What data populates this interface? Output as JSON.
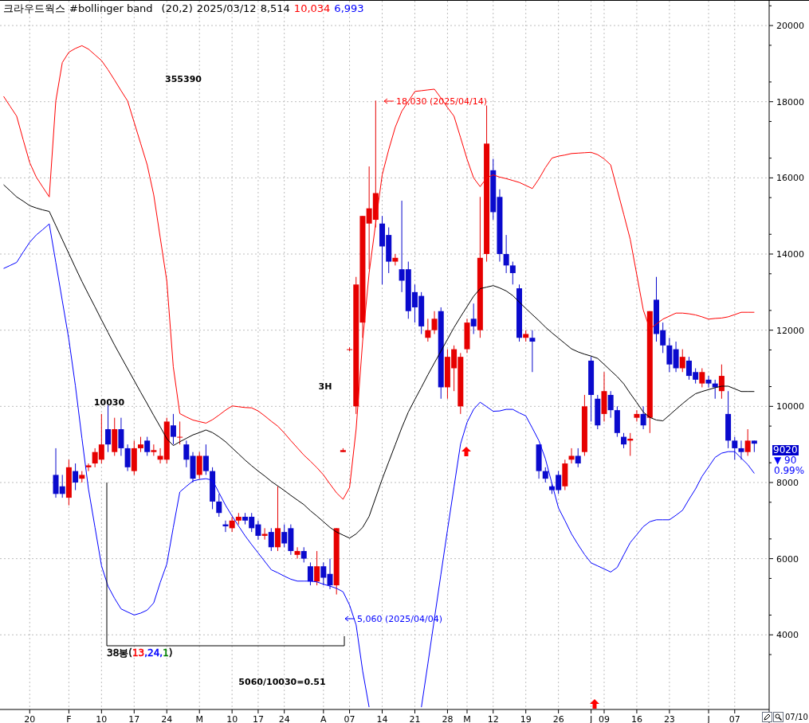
{
  "header": {
    "title": "크라우드웍스",
    "indicator": "#bollinger band",
    "params": "(20,2)",
    "date": "2025/03/12",
    "close": "8,514",
    "upper": "10,034",
    "lower": "6,993"
  },
  "price_tag": {
    "price": "9020",
    "change": "▼ 90",
    "percent": "0.99%"
  },
  "footer": {
    "date_label": "07/10"
  },
  "chart": {
    "range_label": [
      {
        "text": "38봉(",
        "color": "#000000"
      },
      {
        "text": "13",
        "color": "#ff0000"
      },
      {
        "text": ",24,",
        "color": "#0000ff"
      },
      {
        "text": "1",
        "color": "#008000"
      },
      {
        "text": ")",
        "color": "#000000"
      }
    ],
    "chart_data": {
      "type": "candlestick",
      "grid": true,
      "ylim": [
        2040,
        20650
      ],
      "yticks": [
        4000,
        6000,
        8000,
        10000,
        12000,
        14000,
        16000,
        18000,
        20000
      ],
      "categories": [
        null,
        null,
        null,
        null,
        "20",
        null,
        null,
        null,
        null,
        null,
        "F",
        null,
        null,
        null,
        null,
        "10",
        null,
        null,
        null,
        null,
        "17",
        null,
        null,
        null,
        null,
        "24",
        null,
        null,
        null,
        null,
        "M",
        null,
        null,
        null,
        null,
        "10",
        null,
        null,
        null,
        "17",
        null,
        null,
        null,
        "24",
        null,
        null,
        null,
        null,
        null,
        "A",
        null,
        null,
        null,
        "07",
        null,
        null,
        null,
        null,
        "14",
        null,
        null,
        null,
        null,
        "21",
        null,
        null,
        null,
        null,
        "28",
        null,
        null,
        "M",
        null,
        null,
        null,
        "12",
        null,
        null,
        null,
        null,
        "19",
        null,
        null,
        null,
        null,
        "26",
        null,
        null,
        null,
        null,
        "J",
        null,
        "09",
        null,
        null,
        null,
        null,
        "16",
        null,
        null,
        null,
        null,
        "23",
        null,
        null,
        null,
        null,
        null,
        "J",
        null,
        null,
        null,
        "07",
        null,
        null,
        null
      ],
      "series": [
        {
          "type": "line",
          "color": "#ff0000",
          "values": [
            18140,
            17880,
            17620,
            17000,
            16400,
            16020,
            15760,
            15500,
            18020,
            19030,
            19300,
            19400,
            19470,
            19380,
            19230,
            19080,
            18840,
            18570,
            18290,
            18020,
            17460,
            16900,
            16340,
            15550,
            14420,
            13290,
            11040,
            9810,
            9720,
            9640,
            9600,
            9560,
            9650,
            9770,
            9900,
            10010,
            9990,
            9970,
            9960,
            9880,
            9750,
            9610,
            9480,
            9300,
            9100,
            8910,
            8720,
            8560,
            8390,
            8200,
            7960,
            7730,
            7560,
            7870,
            9400,
            11720,
            13500,
            14800,
            16080,
            16740,
            17330,
            17750,
            18010,
            18270,
            18290,
            18310,
            18330,
            18100,
            17850,
            17620,
            17060,
            16490,
            16000,
            15770,
            16000,
            16080,
            16020,
            15980,
            15930,
            15880,
            15800,
            15720,
            15970,
            16270,
            16520,
            16570,
            16600,
            16640,
            16650,
            16660,
            16670,
            16610,
            16500,
            16340,
            15690,
            15040,
            14390,
            13460,
            12530,
            12030,
            12160,
            12290,
            12370,
            12450,
            12450,
            12430,
            12400,
            12350,
            12290,
            12310,
            12320,
            12350,
            12410,
            12470,
            12470,
            12470
          ]
        },
        {
          "type": "line",
          "color": "#000000",
          "values": [
            15820,
            15660,
            15500,
            15390,
            15270,
            15210,
            15160,
            15120,
            14750,
            14380,
            14010,
            13640,
            13280,
            12940,
            12610,
            12270,
            11940,
            11610,
            11300,
            10990,
            10680,
            10370,
            10070,
            9760,
            9460,
            9150,
            8970,
            9070,
            9160,
            9250,
            9310,
            9380,
            9310,
            9200,
            9070,
            8910,
            8750,
            8590,
            8440,
            8300,
            8170,
            8030,
            7910,
            7790,
            7660,
            7540,
            7420,
            7260,
            7120,
            6970,
            6820,
            6700,
            6620,
            6540,
            6650,
            6820,
            7110,
            7600,
            8090,
            8540,
            8990,
            9440,
            9850,
            10180,
            10500,
            10830,
            11140,
            11450,
            11760,
            12070,
            12350,
            12620,
            12890,
            13090,
            13130,
            13170,
            13110,
            13030,
            12910,
            12740,
            12570,
            12410,
            12250,
            12080,
            11930,
            11790,
            11650,
            11510,
            11430,
            11370,
            11320,
            11260,
            11100,
            10940,
            10780,
            10590,
            10340,
            10100,
            9850,
            9710,
            9640,
            9620,
            9770,
            9920,
            10070,
            10210,
            10330,
            10390,
            10440,
            10490,
            10530,
            10530,
            10460,
            10390,
            10390,
            10390
          ]
        },
        {
          "type": "line",
          "color": "#0000ff",
          "values": [
            13620,
            13700,
            13780,
            14050,
            14310,
            14500,
            14640,
            14790,
            13780,
            12770,
            11760,
            10540,
            9160,
            7830,
            6820,
            5810,
            5280,
            4960,
            4680,
            4600,
            4520,
            4570,
            4650,
            4840,
            5380,
            5860,
            6820,
            7750,
            7900,
            8040,
            8080,
            8100,
            8060,
            7730,
            7400,
            7120,
            6860,
            6600,
            6370,
            6150,
            5930,
            5710,
            5630,
            5540,
            5460,
            5410,
            5410,
            5410,
            5390,
            5330,
            5280,
            5220,
            5130,
            4780,
            4260,
            3050,
            2100,
            null,
            null,
            null,
            null,
            null,
            null,
            null,
            2100,
            3250,
            4420,
            5590,
            6750,
            7880,
            9010,
            9580,
            9920,
            10110,
            9990,
            9870,
            9880,
            9920,
            9920,
            9830,
            9750,
            9430,
            9100,
            8620,
            7970,
            7330,
            7000,
            6650,
            6370,
            6110,
            5890,
            5810,
            5730,
            5650,
            5770,
            6100,
            6420,
            6630,
            6840,
            6970,
            7020,
            7020,
            7020,
            7140,
            7270,
            7560,
            7830,
            8160,
            8410,
            8660,
            8770,
            8810,
            8810,
            8640,
            8470,
            8240
          ]
        }
      ],
      "ohlc": [
        null,
        null,
        null,
        null,
        null,
        null,
        null,
        null,
        [
          8200,
          8900,
          7600,
          7700
        ],
        [
          7900,
          8200,
          7600,
          7700
        ],
        [
          7600,
          8600,
          7400,
          8400
        ],
        [
          8300,
          8500,
          7800,
          8000
        ],
        [
          8100,
          8300,
          8000,
          8200
        ],
        [
          8400,
          8500,
          8300,
          8450
        ],
        [
          8500,
          8900,
          8400,
          8800
        ],
        [
          8600,
          9800,
          8500,
          9000
        ],
        [
          9400,
          10030,
          8800,
          9000
        ],
        [
          8800,
          9700,
          8700,
          9400
        ],
        [
          9400,
          9700,
          8700,
          8900
        ],
        [
          8900,
          9000,
          8300,
          8400
        ],
        [
          8300,
          9100,
          8200,
          8900
        ],
        [
          8900,
          9200,
          8800,
          9000
        ],
        [
          9100,
          9200,
          8700,
          8800
        ],
        [
          8800,
          9000,
          8700,
          8850
        ],
        [
          8600,
          8900,
          8500,
          8700
        ],
        [
          8600,
          9700,
          8500,
          9600
        ],
        [
          9500,
          9800,
          9000,
          9200
        ],
        [
          9200,
          9600,
          9000,
          9200
        ],
        [
          9000,
          9100,
          8400,
          8600
        ],
        [
          8700,
          8800,
          8000,
          8100
        ],
        [
          8200,
          8800,
          8100,
          8700
        ],
        [
          8700,
          9000,
          8200,
          8300
        ],
        [
          8300,
          8400,
          7300,
          7500
        ],
        [
          7500,
          7700,
          7100,
          7200
        ],
        [
          6900,
          7000,
          6700,
          6850
        ],
        [
          6800,
          7100,
          6700,
          7000
        ],
        [
          7000,
          7200,
          6900,
          7100
        ],
        [
          7100,
          7200,
          6900,
          7000
        ],
        [
          7100,
          7200,
          6700,
          6800
        ],
        [
          6900,
          7000,
          6500,
          6600
        ],
        [
          6600,
          6800,
          6500,
          6650
        ],
        [
          6700,
          6800,
          6200,
          6300
        ],
        [
          6300,
          7900,
          6200,
          6800
        ],
        [
          6700,
          6900,
          6300,
          6400
        ],
        [
          6800,
          6900,
          6100,
          6200
        ],
        [
          6100,
          6300,
          6000,
          6200
        ],
        [
          6200,
          6300,
          5900,
          6000
        ],
        [
          5800,
          5900,
          5300,
          5400
        ],
        [
          5400,
          6200,
          5300,
          5800
        ],
        [
          5800,
          5900,
          5300,
          5500
        ],
        [
          5600,
          6000,
          5200,
          5300
        ],
        [
          5300,
          6800,
          5060,
          6800
        ],
        [
          8800,
          8900,
          8800,
          8850
        ],
        [
          11500,
          11550,
          11450,
          11500
        ],
        [
          10000,
          13400,
          9800,
          13200
        ],
        [
          12200,
          15000,
          11800,
          15000
        ],
        [
          14800,
          16300,
          13600,
          15200
        ],
        [
          14900,
          18030,
          14700,
          15600
        ],
        [
          14800,
          15000,
          13200,
          14200
        ],
        [
          14500,
          14700,
          13500,
          13800
        ],
        [
          13800,
          14000,
          13700,
          13900
        ],
        [
          13600,
          15400,
          13000,
          13300
        ],
        [
          13600,
          13800,
          12300,
          12500
        ],
        [
          13000,
          13200,
          12200,
          12600
        ],
        [
          12900,
          13000,
          11900,
          12100
        ],
        [
          11800,
          12300,
          11700,
          12000
        ],
        [
          12000,
          12500,
          11900,
          12300
        ],
        [
          12500,
          12600,
          10200,
          10500
        ],
        [
          10500,
          11500,
          10200,
          11300
        ],
        [
          11000,
          11600,
          10400,
          11500
        ],
        [
          10000,
          11400,
          9800,
          11300
        ],
        [
          11500,
          12300,
          11400,
          12200
        ],
        [
          12300,
          12700,
          11900,
          12100
        ],
        [
          12000,
          15500,
          11800,
          13900
        ],
        [
          14000,
          17900,
          13800,
          16900
        ],
        [
          16200,
          16500,
          14900,
          15100
        ],
        [
          15500,
          15700,
          13800,
          14000
        ],
        [
          14000,
          14500,
          13500,
          13700
        ],
        [
          13700,
          13800,
          13200,
          13500
        ],
        [
          13100,
          13200,
          11700,
          11800
        ],
        [
          11800,
          12000,
          11700,
          11900
        ],
        [
          11800,
          12000,
          10900,
          11700
        ],
        [
          9000,
          9000,
          8100,
          8300
        ],
        [
          8300,
          8400,
          8000,
          8100
        ],
        [
          7900,
          8000,
          7700,
          7800
        ],
        [
          8200,
          8300,
          7700,
          7800
        ],
        [
          7900,
          8600,
          7800,
          8500
        ],
        [
          8600,
          8900,
          8500,
          8700
        ],
        [
          8700,
          8900,
          8400,
          8500
        ],
        [
          8800,
          10300,
          8700,
          10000
        ],
        [
          11200,
          11300,
          9600,
          10300
        ],
        [
          10200,
          10300,
          9400,
          9500
        ],
        [
          9800,
          10900,
          9600,
          10400
        ],
        [
          10300,
          10400,
          9700,
          9900
        ],
        [
          9900,
          10000,
          9200,
          9300
        ],
        [
          9200,
          9300,
          8900,
          9000
        ],
        [
          9100,
          9300,
          8700,
          9150
        ],
        [
          9700,
          9900,
          9600,
          9800
        ],
        [
          9800,
          10000,
          9400,
          9500
        ],
        [
          9700,
          12500,
          9300,
          12500
        ],
        [
          12800,
          13400,
          11700,
          11900
        ],
        [
          12000,
          12200,
          11400,
          11600
        ],
        [
          11600,
          11800,
          10900,
          11100
        ],
        [
          11500,
          11700,
          10900,
          11000
        ],
        [
          11000,
          11500,
          10900,
          11300
        ],
        [
          11200,
          11300,
          10700,
          10800
        ],
        [
          10900,
          11000,
          10600,
          10700
        ],
        [
          10600,
          11000,
          10500,
          10900
        ],
        [
          10700,
          10800,
          10500,
          10600
        ],
        [
          10600,
          10700,
          10200,
          10500
        ],
        [
          10400,
          11100,
          10200,
          10800
        ],
        [
          9800,
          10400,
          8900,
          9100
        ],
        [
          9100,
          9200,
          8600,
          8900
        ],
        [
          8900,
          9100,
          8600,
          8800
        ],
        [
          8800,
          9400,
          8700,
          9100
        ],
        [
          9100,
          9100,
          8800,
          9020
        ]
      ],
      "annotations": [
        "355390",
        "10030",
        "3H",
        "5060/10030=0.51",
        "18,030 (2025/04/14)",
        "5,060 (2025/04/04)"
      ]
    }
  }
}
